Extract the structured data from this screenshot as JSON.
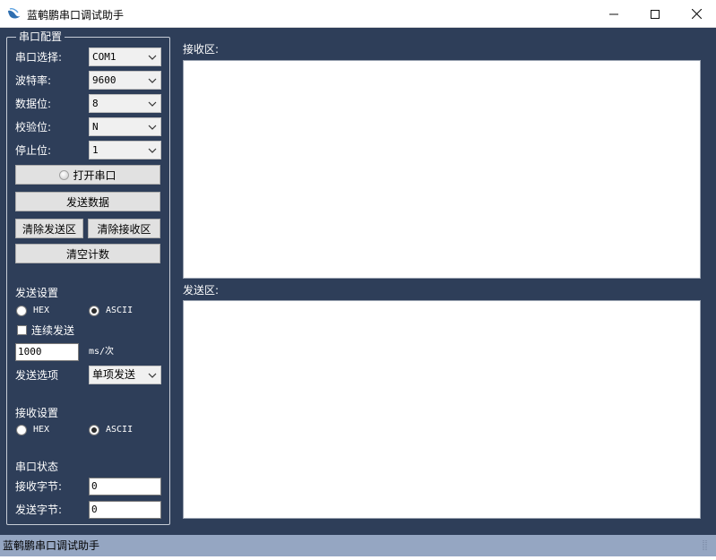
{
  "window": {
    "title": "蓝鹌鹏串口调试助手",
    "icon": "app-bird-icon",
    "minimize_icon": "minimize-icon",
    "maximize_icon": "maximize-icon",
    "close_icon": "close-icon"
  },
  "config_group": {
    "title": "串口配置",
    "port_label": "串口选择:",
    "port_value": "COM1",
    "baud_label": "波特率:",
    "baud_value": "9600",
    "databits_label": "数据位:",
    "databits_value": "8",
    "parity_label": "校验位:",
    "parity_value": "N",
    "stopbits_label": "停止位:",
    "stopbits_value": "1",
    "open_port_button": "打开串口",
    "send_data_button": "发送数据",
    "clear_send_button": "清除发送区",
    "clear_receive_button": "清除接收区",
    "clear_count_button": "清空计数"
  },
  "send_settings": {
    "title": "发送设置",
    "hex_label": "HEX",
    "ascii_label": "ASCII",
    "selected": "ASCII",
    "continuous_label": "连续发送",
    "continuous_checked": false,
    "interval_value": "1000",
    "interval_unit": "ms/次",
    "options_label": "发送选项",
    "options_value": "单项发送"
  },
  "receive_settings": {
    "title": "接收设置",
    "hex_label": "HEX",
    "ascii_label": "ASCII",
    "selected": "ASCII"
  },
  "port_status": {
    "title": "串口状态",
    "rx_label": "接收字节:",
    "rx_value": "0",
    "tx_label": "发送字节:",
    "tx_value": "0"
  },
  "receive_area": {
    "label": "接收区:"
  },
  "send_area": {
    "label": "发送区:"
  },
  "statusbar": {
    "text": "蓝鹌鹏串口调试助手"
  },
  "colors": {
    "background": "#2e3e59",
    "statusbar": "#95a6c2"
  }
}
